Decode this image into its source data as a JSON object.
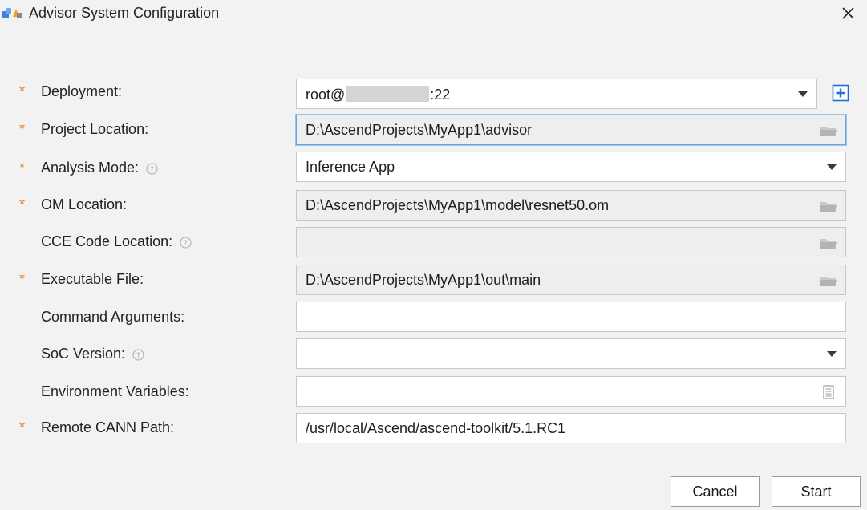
{
  "window": {
    "title": "Advisor System Configuration"
  },
  "form": {
    "deployment": {
      "label": "Deployment:",
      "value_prefix": "root@",
      "value_suffix": ":22",
      "required": true
    },
    "project_location": {
      "label": "Project Location:",
      "value": "D:\\AscendProjects\\MyApp1\\advisor",
      "required": true
    },
    "analysis_mode": {
      "label": "Analysis Mode:",
      "value": "Inference App",
      "required": true
    },
    "om_location": {
      "label": "OM Location:",
      "value": "D:\\AscendProjects\\MyApp1\\model\\resnet50.om",
      "required": true
    },
    "cce_code_location": {
      "label": "CCE Code Location:",
      "value": "",
      "required": false
    },
    "executable_file": {
      "label": "Executable File:",
      "value": "D:\\AscendProjects\\MyApp1\\out\\main",
      "required": true
    },
    "command_arguments": {
      "label": "Command Arguments:",
      "value": "",
      "required": false
    },
    "soc_version": {
      "label": "SoC Version:",
      "value": "",
      "required": false
    },
    "environment_variables": {
      "label": "Environment Variables:",
      "value": "",
      "required": false
    },
    "remote_cann_path": {
      "label": "Remote CANN Path:",
      "value": "/usr/local/Ascend/ascend-toolkit/5.1.RC1",
      "required": true
    }
  },
  "required_marker": "*",
  "buttons": {
    "cancel": "Cancel",
    "start": "Start"
  },
  "colors": {
    "required_star": "#e8841c",
    "add_button": "#1e6fd9",
    "focus_border": "#6fa4d6"
  }
}
